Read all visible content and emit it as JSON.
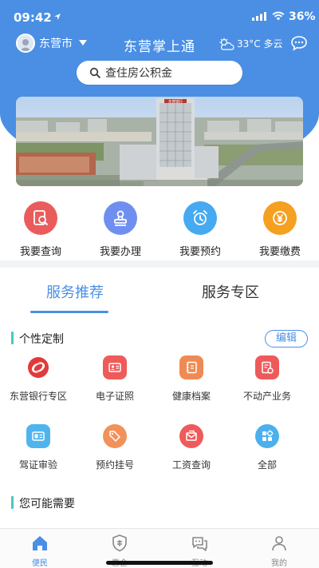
{
  "status": {
    "time": "09:42",
    "battery": "36%"
  },
  "header": {
    "city": "东营市",
    "title": "东营掌上通",
    "weather": "33°C 多云"
  },
  "search": {
    "placeholder": "查住房公积金"
  },
  "banner": {
    "building_sign": "东营银行"
  },
  "quick_actions": [
    {
      "label": "我要查询",
      "icon": "query-icon",
      "color": "#ea5c5c"
    },
    {
      "label": "我要办理",
      "icon": "stamp-icon",
      "color": "#6f8ff0"
    },
    {
      "label": "我要预约",
      "icon": "alarm-clock-icon",
      "color": "#45aaf0"
    },
    {
      "label": "我要缴费",
      "icon": "yen-coin-icon",
      "color": "#f5a021"
    }
  ],
  "tabs": [
    {
      "label": "服务推荐",
      "active": true
    },
    {
      "label": "服务专区",
      "active": false
    }
  ],
  "custom_section": {
    "title": "个性定制",
    "edit_label": "编辑"
  },
  "services": [
    {
      "label": "东营银行专区",
      "icon": "bank-logo-icon",
      "color": "#e23a3a"
    },
    {
      "label": "电子证照",
      "icon": "id-card-icon",
      "color": "#ef5a5a"
    },
    {
      "label": "健康档案",
      "icon": "health-record-icon",
      "color": "#f18a52"
    },
    {
      "label": "不动产业务",
      "icon": "property-doc-icon",
      "color": "#ee5a5a"
    },
    {
      "label": "驾证审验",
      "icon": "license-icon",
      "color": "#4fb4ee"
    },
    {
      "label": "预约挂号",
      "icon": "tag-icon",
      "color": "#f2925a"
    },
    {
      "label": "工资查询",
      "icon": "wage-envelope-icon",
      "color": "#ef5a5a"
    },
    {
      "label": "全部",
      "icon": "grid-apps-icon",
      "color": "#4db0ee"
    }
  ],
  "maybe_section": {
    "title": "您可能需要"
  },
  "bottom_nav": [
    {
      "label": "便民",
      "icon": "home-icon",
      "active": true
    },
    {
      "label": "惠企",
      "icon": "enterprise-shield-icon",
      "active": false
    },
    {
      "label": "互动",
      "icon": "chat-bubbles-icon",
      "active": false
    },
    {
      "label": "我的",
      "icon": "person-icon",
      "active": false
    }
  ]
}
